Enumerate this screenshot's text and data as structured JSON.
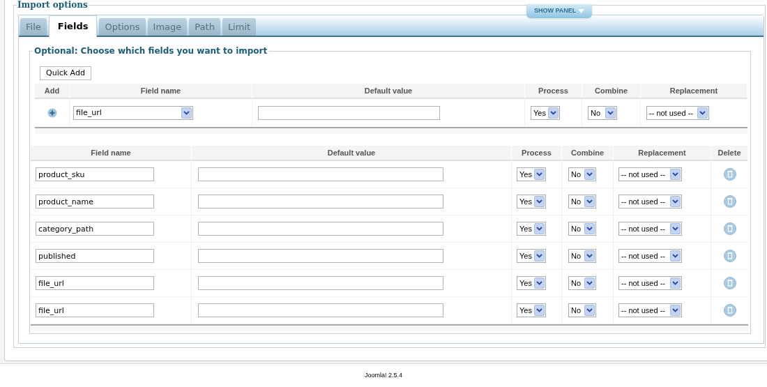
{
  "fieldset_title": "Import options",
  "show_panel": "SHOW PANEL",
  "tabs": [
    {
      "label": "File",
      "selected": false
    },
    {
      "label": "Fields",
      "selected": true
    },
    {
      "label": "Options",
      "selected": false
    },
    {
      "label": "Image",
      "selected": false
    },
    {
      "label": "Path",
      "selected": false
    },
    {
      "label": "Limit",
      "selected": false
    }
  ],
  "optional_title": "Optional: Choose which fields you want to import",
  "quick_add": "Quick Add",
  "add_table": {
    "columns": [
      "Add",
      "Field name",
      "Default value",
      "Process",
      "Combine",
      "Replacement"
    ],
    "row": {
      "field_name": "file_url",
      "process": "Yes",
      "combine": "No",
      "replacement": "-- not used --"
    }
  },
  "fields_table": {
    "columns": [
      "Field name",
      "Default value",
      "Process",
      "Combine",
      "Replacement",
      "Delete"
    ],
    "rows": [
      {
        "field_name": "product_sku",
        "process": "Yes",
        "combine": "No",
        "replacement": "-- not used --"
      },
      {
        "field_name": "product_name",
        "process": "Yes",
        "combine": "No",
        "replacement": "-- not used --"
      },
      {
        "field_name": "category_path",
        "process": "Yes",
        "combine": "No",
        "replacement": "-- not used --"
      },
      {
        "field_name": "published",
        "process": "Yes",
        "combine": "No",
        "replacement": "-- not used --"
      },
      {
        "field_name": "file_url",
        "process": "Yes",
        "combine": "No",
        "replacement": "-- not used --"
      },
      {
        "field_name": "file_url",
        "process": "Yes",
        "combine": "No",
        "replacement": "-- not used --"
      }
    ]
  },
  "footer": "Joomla! 2.5.4"
}
